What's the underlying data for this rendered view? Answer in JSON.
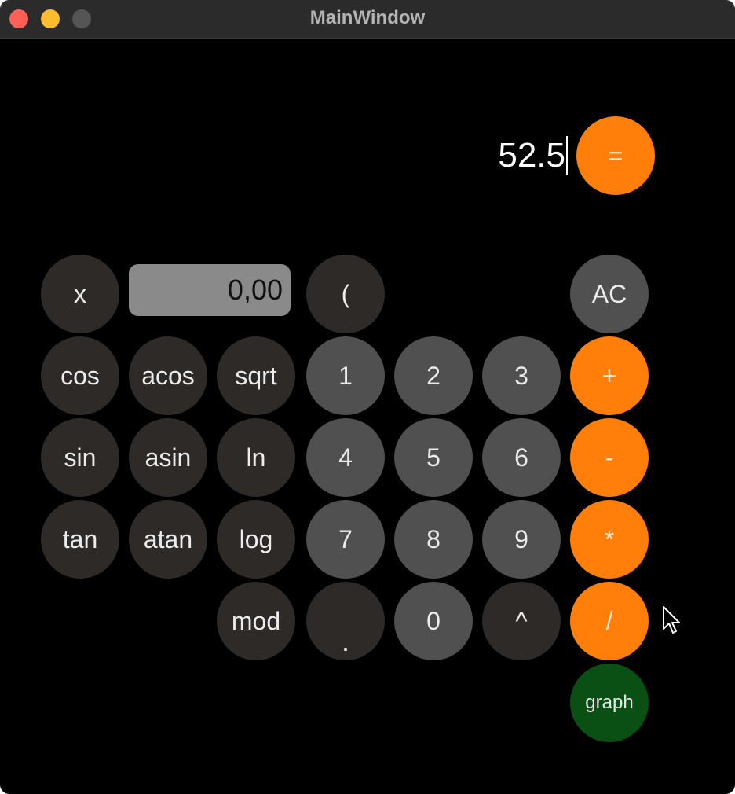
{
  "window": {
    "title": "MainWindow"
  },
  "display": {
    "expression": "52.5"
  },
  "x_field": {
    "value": "0,00"
  },
  "buttons": {
    "equals": "=",
    "x": "x",
    "open_paren": "(",
    "all_clear": "AC",
    "cos": "cos",
    "acos": "acos",
    "sqrt": "sqrt",
    "one": "1",
    "two": "2",
    "three": "3",
    "plus": "+",
    "sin": "sin",
    "asin": "asin",
    "ln": "ln",
    "four": "4",
    "five": "5",
    "six": "6",
    "minus": "-",
    "tan": "tan",
    "atan": "atan",
    "log": "log",
    "seven": "7",
    "eight": "8",
    "nine": "9",
    "multiply": "*",
    "mod": "mod",
    "decimal": ".",
    "zero": "0",
    "power": "^",
    "divide": "/",
    "graph": "graph"
  },
  "colors": {
    "function_button": "#2e2a28",
    "digit_button": "#505050",
    "operator_button": "#ff7f0a",
    "graph_button": "#0a5014",
    "background": "#000000"
  }
}
